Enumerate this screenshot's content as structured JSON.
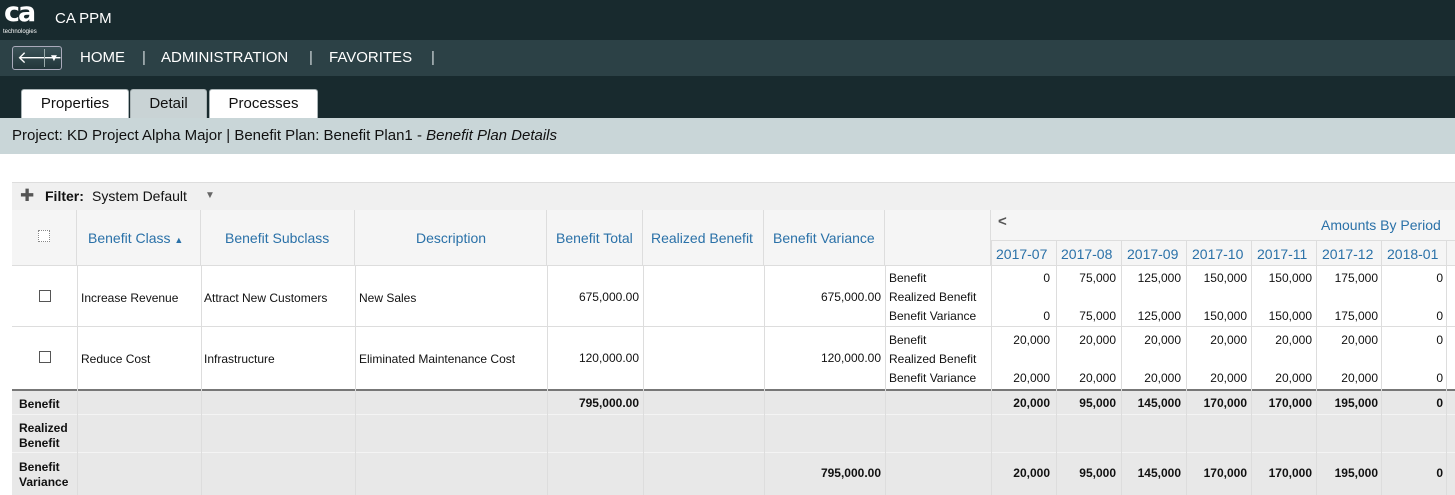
{
  "app": {
    "logo_text": "ca",
    "logo_sub": "technologies",
    "title": "CA PPM"
  },
  "nav": {
    "items": [
      "HOME",
      "ADMINISTRATION",
      "FAVORITES"
    ],
    "separator": "|"
  },
  "tabs": [
    "Properties",
    "Detail",
    "Processes"
  ],
  "page_title": {
    "main": "Project: KD Project Alpha Major | Benefit Plan: Benefit Plan1 - ",
    "italic": "Benefit Plan Details"
  },
  "filter": {
    "label": "Filter:",
    "value": "System Default"
  },
  "columns": {
    "benefit_class": "Benefit Class",
    "benefit_subclass": "Benefit Subclass",
    "description": "Description",
    "benefit_total": "Benefit Total",
    "realized_benefit": "Realized Benefit",
    "benefit_variance": "Benefit Variance",
    "amounts_by_period": "Amounts By Period"
  },
  "periods": [
    "2017-07",
    "2017-08",
    "2017-09",
    "2017-10",
    "2017-11",
    "2017-12",
    "2018-01"
  ],
  "metric_labels": [
    "Benefit",
    "Realized Benefit",
    "Benefit Variance"
  ],
  "rows": [
    {
      "benefit_class": "Increase Revenue",
      "benefit_subclass": "Attract New Customers",
      "description": "New Sales",
      "benefit_total": "675,000.00",
      "realized_benefit": "",
      "benefit_variance": "675,000.00",
      "benefit": [
        "0",
        "75,000",
        "125,000",
        "150,000",
        "150,000",
        "175,000",
        "0"
      ],
      "variance": [
        "0",
        "75,000",
        "125,000",
        "150,000",
        "150,000",
        "175,000",
        "0"
      ]
    },
    {
      "benefit_class": "Reduce Cost",
      "benefit_subclass": "Infrastructure",
      "description": "Eliminated Maintenance Cost",
      "benefit_total": "120,000.00",
      "realized_benefit": "",
      "benefit_variance": "120,000.00",
      "benefit": [
        "20,000",
        "20,000",
        "20,000",
        "20,000",
        "20,000",
        "20,000",
        "0"
      ],
      "variance": [
        "20,000",
        "20,000",
        "20,000",
        "20,000",
        "20,000",
        "20,000",
        "0"
      ]
    }
  ],
  "totals": {
    "benefit": {
      "label": "Benefit",
      "benefit_total": "795,000.00",
      "periods": [
        "20,000",
        "95,000",
        "145,000",
        "170,000",
        "170,000",
        "195,000",
        "0"
      ]
    },
    "realized": {
      "label_line1": "Realized",
      "label_line2": "Benefit"
    },
    "variance": {
      "label_line1": "Benefit",
      "label_line2": "Variance",
      "benefit_variance": "795,000.00",
      "periods": [
        "20,000",
        "95,000",
        "145,000",
        "170,000",
        "170,000",
        "195,000",
        "0"
      ]
    }
  },
  "colors": {
    "topbar": "#182a2e",
    "navbar": "#2c4146",
    "titlebar": "#c9d6d8",
    "link": "#2a71a8"
  },
  "icons": {
    "back": "back-arrow-icon",
    "dropdown": "caret-down-icon",
    "plus": "plus-icon",
    "sort": "sort-asc-icon",
    "scroll_left": "chevron-left-icon"
  }
}
